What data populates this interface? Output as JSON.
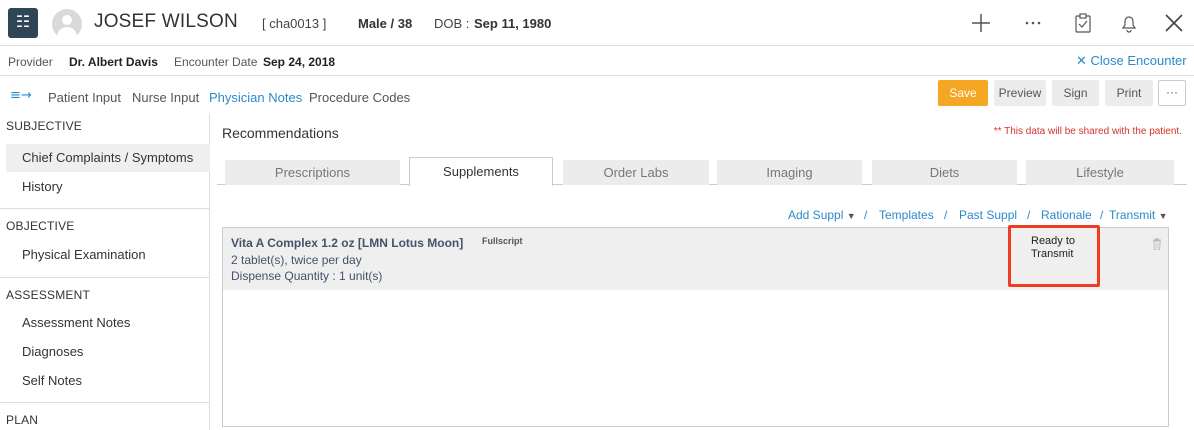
{
  "header": {
    "app_icon": "user-grid-icon",
    "patient_name": "JOSEF WILSON",
    "patient_id": "[ cha0013 ]",
    "gender_age": "Male / 38",
    "dob_label": "DOB :",
    "dob": "Sep 11, 1980",
    "icons": [
      "plus-icon",
      "ellipsis-icon",
      "clipboard-icon",
      "bell-icon",
      "close-icon"
    ]
  },
  "encounter": {
    "provider_label": "Provider",
    "provider": "Dr. Albert Davis",
    "date_label": "Encounter Date",
    "date": "Sep 24, 2018",
    "close_label": "✕ Close Encounter"
  },
  "tabs": {
    "items": [
      "Patient Input",
      "Nurse Input",
      "Physician Notes",
      "Procedure Codes"
    ],
    "active": "Physician Notes"
  },
  "toolbar": {
    "save": "Save",
    "preview": "Preview",
    "sign": "Sign",
    "print": "Print",
    "more": "···"
  },
  "sidebar": {
    "sections": [
      {
        "title": "SUBJECTIVE",
        "items": [
          "Chief Complaints / Symptoms",
          "History"
        ]
      },
      {
        "title": "OBJECTIVE",
        "items": [
          "Physical Examination"
        ]
      },
      {
        "title": "ASSESSMENT",
        "items": [
          "Assessment Notes",
          "Diagnoses",
          "Self Notes"
        ]
      },
      {
        "title": "PLAN",
        "items": []
      }
    ],
    "active_item": "Chief Complaints / Symptoms"
  },
  "main": {
    "title": "Recommendations",
    "share_note": "** This data will be shared with the patient.",
    "subtabs": [
      "Prescriptions",
      "Supplements",
      "Order Labs",
      "Imaging",
      "Diets",
      "Lifestyle"
    ],
    "active_subtab": "Supplements",
    "actions": {
      "add": "Add Suppl",
      "templates": "Templates",
      "past": "Past Suppl",
      "rationale": "Rationale",
      "transmit": "Transmit",
      "separator": "/"
    },
    "supplement": {
      "name": "Vita A Complex 1.2 oz [LMN Lotus Moon]",
      "vendor": "Fullscript",
      "dose": "2 tablet(s),  twice per day",
      "quantity": "Dispense Quantity :  1 unit(s)",
      "status": "Ready to Transmit"
    }
  },
  "colors": {
    "accent": "#2a8bc9",
    "save": "#f5a623",
    "highlight": "#ef3b24",
    "app_icon_bg": "#2f4656"
  }
}
